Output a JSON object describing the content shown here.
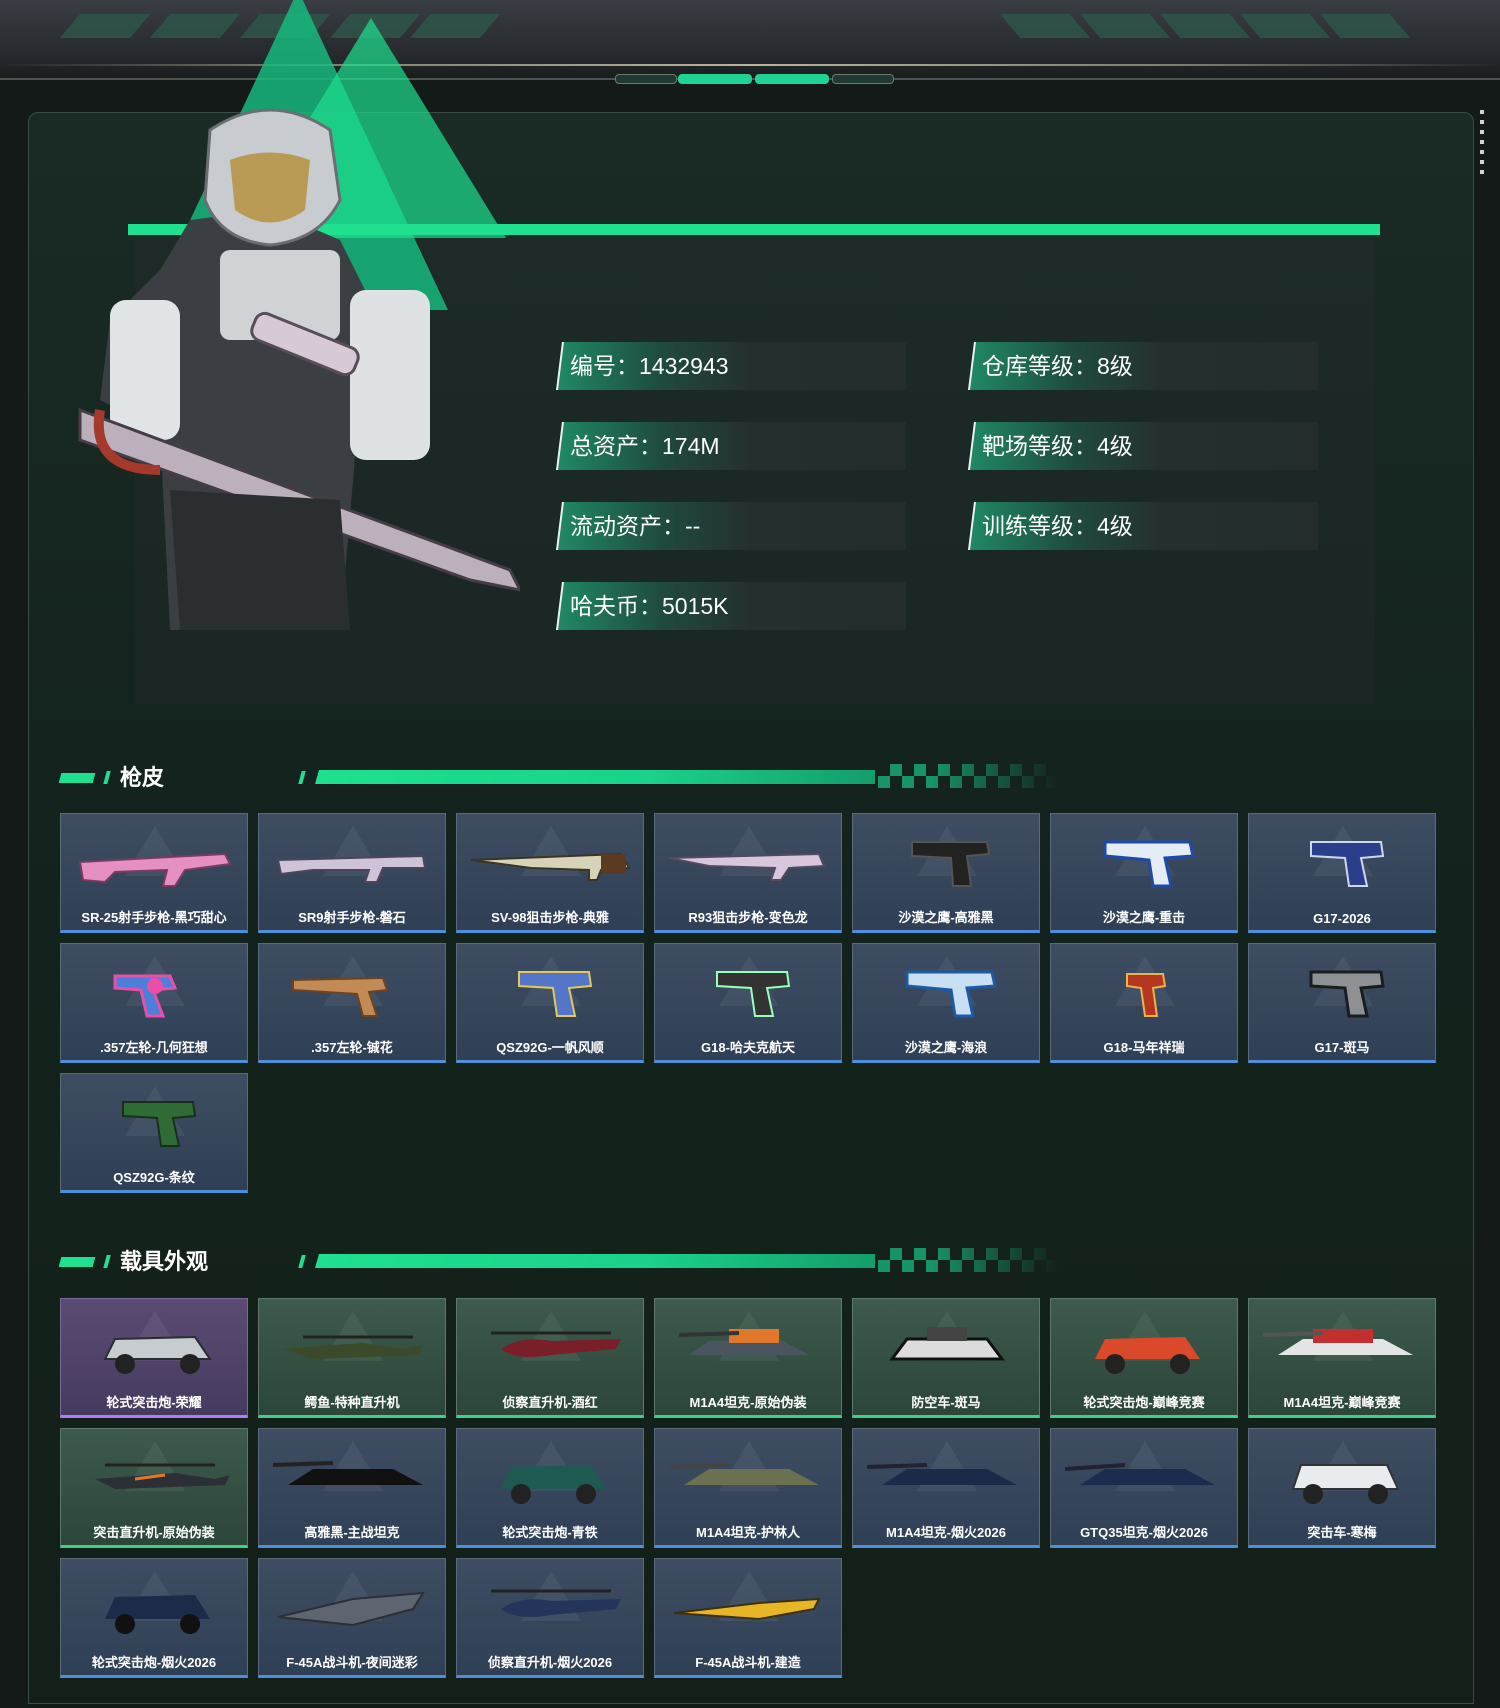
{
  "profile": {
    "stats_left": [
      {
        "label": "编号：1432943"
      },
      {
        "label": "总资产：174M"
      },
      {
        "label": "流动资产：--"
      },
      {
        "label": "哈夫币：5015K"
      }
    ],
    "stats_right": [
      {
        "label": "仓库等级：8级"
      },
      {
        "label": "靶场等级：4级"
      },
      {
        "label": "训练等级：4级"
      }
    ]
  },
  "sections": {
    "gun_skins_title": "枪皮",
    "vehicle_skins_title": "载具外观"
  },
  "gun_skins": [
    {
      "name": "SR-25射手步枪-黑巧甜心",
      "rarity": "blue"
    },
    {
      "name": "SR9射手步枪-磐石",
      "rarity": "blue"
    },
    {
      "name": "SV-98狙击步枪-典雅",
      "rarity": "blue"
    },
    {
      "name": "R93狙击步枪-变色龙",
      "rarity": "blue"
    },
    {
      "name": "沙漠之鹰-高雅黑",
      "rarity": "blue"
    },
    {
      "name": "沙漠之鹰-重击",
      "rarity": "blue"
    },
    {
      "name": "G17-2026",
      "rarity": "blue"
    },
    {
      "name": ".357左轮-几何狂想",
      "rarity": "blue"
    },
    {
      "name": ".357左轮-铖花",
      "rarity": "blue"
    },
    {
      "name": "QSZ92G-一帆风顺",
      "rarity": "blue"
    },
    {
      "name": "G18-哈夫克航天",
      "rarity": "blue"
    },
    {
      "name": "沙漠之鹰-海浪",
      "rarity": "blue"
    },
    {
      "name": "G18-马年祥瑞",
      "rarity": "blue"
    },
    {
      "name": "G17-斑马",
      "rarity": "blue"
    },
    {
      "name": "QSZ92G-条纹",
      "rarity": "blue"
    }
  ],
  "vehicle_skins": [
    {
      "name": "轮式突击炮-荣耀",
      "rarity": "purple"
    },
    {
      "name": "鳄鱼-特种直升机",
      "rarity": "green"
    },
    {
      "name": "侦察直升机-酒红",
      "rarity": "green"
    },
    {
      "name": "M1A4坦克-原始伪装",
      "rarity": "green"
    },
    {
      "name": "防空车-斑马",
      "rarity": "green"
    },
    {
      "name": "轮式突击炮-巅峰竞赛",
      "rarity": "green"
    },
    {
      "name": "M1A4坦克-巅峰竞赛",
      "rarity": "green"
    },
    {
      "name": "突击直升机-原始伪装",
      "rarity": "green"
    },
    {
      "name": "高雅黑-主战坦克",
      "rarity": "blue"
    },
    {
      "name": "轮式突击炮-青铁",
      "rarity": "blue"
    },
    {
      "name": "M1A4坦克-护林人",
      "rarity": "blue"
    },
    {
      "name": "M1A4坦克-烟火2026",
      "rarity": "blue"
    },
    {
      "name": "GTQ35坦克-烟火2026",
      "rarity": "blue"
    },
    {
      "name": "突击车-寒梅",
      "rarity": "blue"
    },
    {
      "name": "轮式突击炮-烟火2026",
      "rarity": "blue"
    },
    {
      "name": "F-45A战斗机-夜间迷彩",
      "rarity": "blue"
    },
    {
      "name": "侦察直升机-烟火2026",
      "rarity": "blue"
    },
    {
      "name": "F-45A战斗机-建造",
      "rarity": "blue"
    }
  ],
  "colors": {
    "accent": "#1ee08f",
    "rarity_blue": "#4d8fd8",
    "rarity_green": "#3ed08a",
    "rarity_purple": "#b17cf1"
  },
  "icons": {
    "gun": "gun-icon",
    "vehicle": "vehicle-icon",
    "character": "soldier-figure"
  }
}
